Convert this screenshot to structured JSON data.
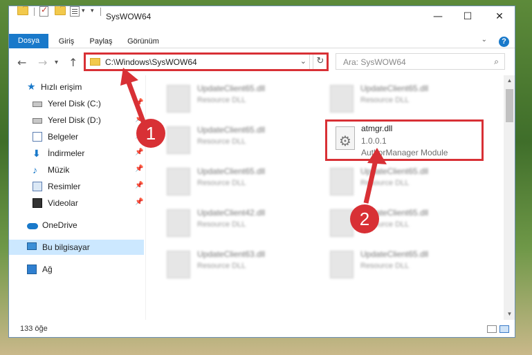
{
  "window": {
    "title": "SysWOW64"
  },
  "ribbon": {
    "tabs": [
      "Dosya",
      "Giriş",
      "Paylaş",
      "Görünüm"
    ]
  },
  "address": {
    "path": "C:\\Windows\\SysWOW64"
  },
  "search": {
    "placeholder": "Ara: SysWOW64"
  },
  "sidebar": {
    "items": [
      {
        "label": "Hızlı erişim",
        "icon": "star-icon"
      },
      {
        "label": "Yerel Disk (C:)",
        "icon": "drive-icon",
        "pinned": true
      },
      {
        "label": "Yerel Disk (D:)",
        "icon": "drive-icon",
        "pinned": true
      },
      {
        "label": "Belgeler",
        "icon": "documents-icon",
        "pinned": true
      },
      {
        "label": "İndirmeler",
        "icon": "downloads-icon",
        "pinned": true
      },
      {
        "label": "Müzik",
        "icon": "music-icon",
        "pinned": true
      },
      {
        "label": "Resimler",
        "icon": "pictures-icon",
        "pinned": true
      },
      {
        "label": "Videolar",
        "icon": "videos-icon",
        "pinned": true
      },
      {
        "label": "OneDrive",
        "icon": "onedrive-icon"
      },
      {
        "label": "Bu bilgisayar",
        "icon": "this-pc-icon",
        "selected": true
      },
      {
        "label": "Ağ",
        "icon": "network-icon"
      }
    ]
  },
  "files": [
    {
      "name": "UpdateClient65.dll",
      "sub": "Resource DLL"
    },
    {
      "name": "UpdateClient65.dll",
      "sub": "Resource DLL"
    },
    {
      "name": "UpdateClient65.dll",
      "sub": "Resource DLL"
    },
    {
      "name": "atmgr.dll",
      "sub": "1.0.0.1",
      "desc": "AuthorManager Module"
    },
    {
      "name": "UpdateClient65.dll",
      "sub": "Resource DLL"
    },
    {
      "name": "UpdateClient65.dll",
      "sub": "Resource DLL"
    },
    {
      "name": "UpdateClient42.dll",
      "sub": "Resource DLL"
    },
    {
      "name": "UpdateClient65.dll",
      "sub": "Resource DLL"
    },
    {
      "name": "UpdateClient63.dll",
      "sub": "Resource DLL"
    },
    {
      "name": "UpdateClient65.dll",
      "sub": "Resource DLL"
    }
  ],
  "status": {
    "count": "133 öğe"
  },
  "callouts": {
    "one": "1",
    "two": "2"
  },
  "colors": {
    "accent": "#1979ca",
    "highlight": "#d83035",
    "selected": "#cce8ff"
  }
}
